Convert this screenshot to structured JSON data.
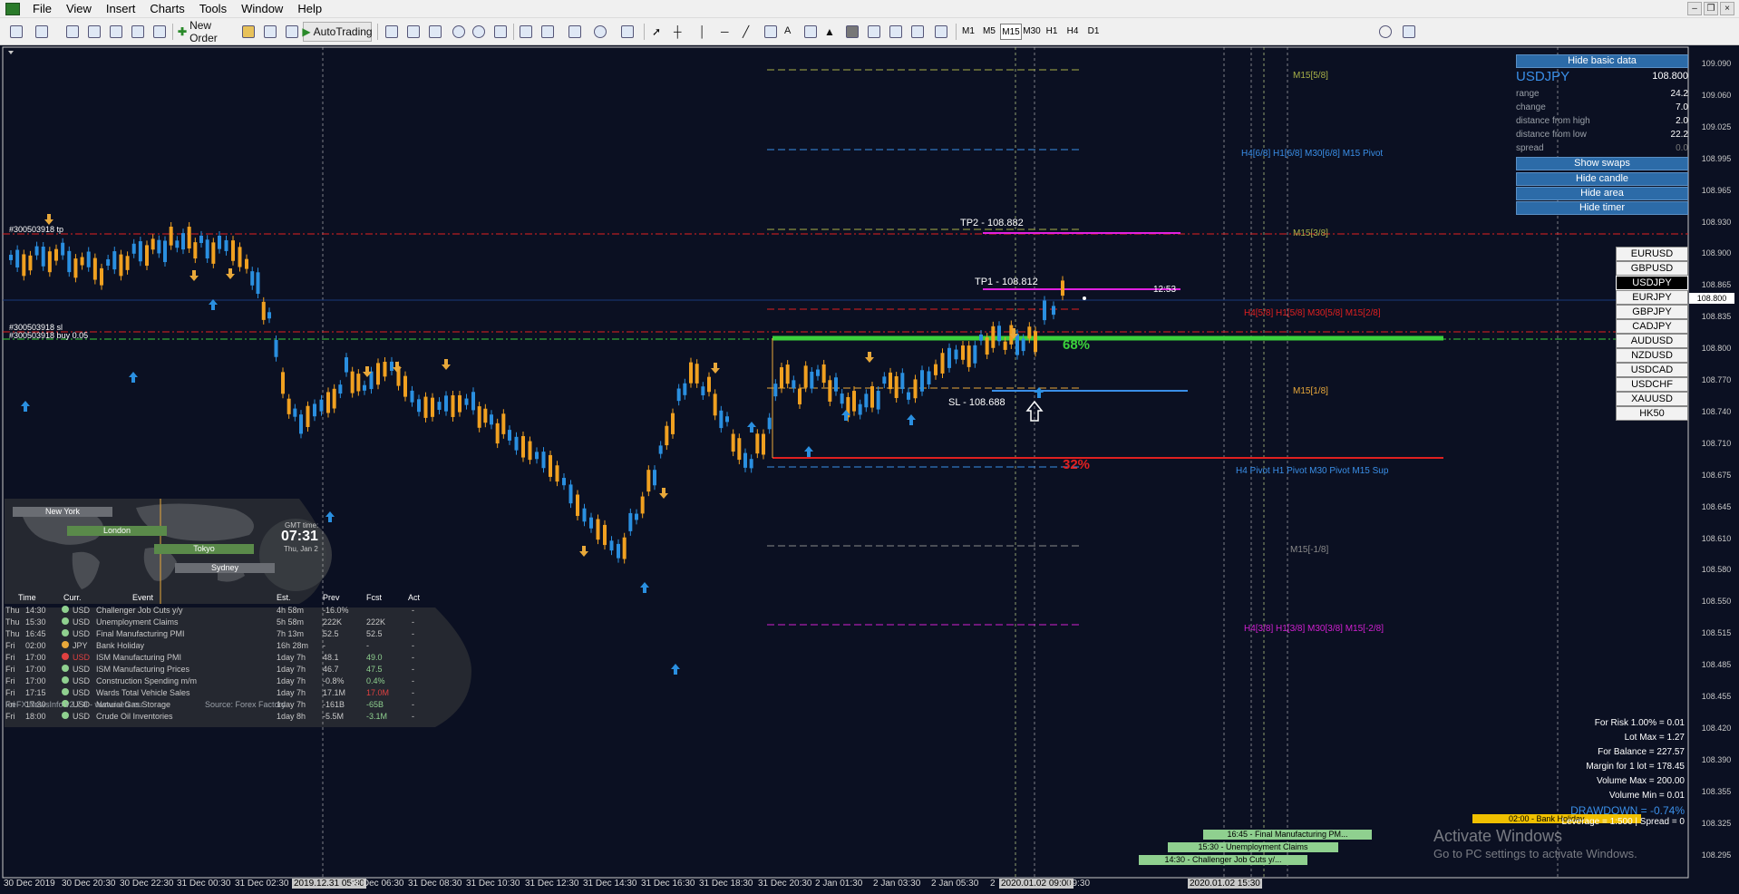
{
  "menu": [
    "File",
    "View",
    "Insert",
    "Charts",
    "Tools",
    "Window",
    "Help"
  ],
  "toolbar": {
    "new_order": "New Order",
    "autotrading": "AutoTrading",
    "timeframes": [
      "M1",
      "M5",
      "M15",
      "M30",
      "H1",
      "H4",
      "D1"
    ],
    "active_timeframe": "M15"
  },
  "price_axis": [
    "109.090",
    "109.060",
    "109.025",
    "108.995",
    "108.965",
    "108.930",
    "108.900",
    "108.865",
    "108.835",
    "108.800",
    "108.770",
    "108.740",
    "108.710",
    "108.675",
    "108.645",
    "108.610",
    "108.580",
    "108.550",
    "108.515",
    "108.485",
    "108.455",
    "108.420",
    "108.390",
    "108.355",
    "108.325",
    "108.295"
  ],
  "current_price": "108.800",
  "time_axis": [
    "30 Dec 2019",
    "30 Dec 20:30",
    "30 Dec 22:30",
    "31 Dec 00:30",
    "31 Dec 02:30",
    "2019.12.31 05:30",
    "31 Dec 06:30",
    "31 Dec 08:30",
    "31 Dec 10:30",
    "31 Dec 12:30",
    "31 Dec 14:30",
    "31 Dec 16:30",
    "31 Dec 18:30",
    "31 Dec 20:30",
    "2 Jan 01:30",
    "2 Jan 03:30",
    "2 Jan 05:30",
    "2",
    "2020.01.02 09:00",
    "09:30",
    "2020.01.02 15:30"
  ],
  "info_panel": {
    "hide_basic": "Hide basic data",
    "symbol": "USDJPY",
    "price": "108.800",
    "rows": [
      {
        "label": "range",
        "value": "24.2"
      },
      {
        "label": "change",
        "value": "7.0"
      },
      {
        "label": "distance from high",
        "value": "2.0"
      },
      {
        "label": "distance from low",
        "value": "22.2"
      },
      {
        "label": "spread",
        "value": "0.0"
      }
    ],
    "buttons": [
      "Show swaps",
      "Hide candle",
      "Hide area",
      "Hide timer"
    ]
  },
  "symbols": [
    "EURUSD",
    "GBPUSD",
    "USDJPY",
    "EURJPY",
    "GBPJPY",
    "CADJPY",
    "AUDUSD",
    "NZDUSD",
    "USDCAD",
    "USDCHF",
    "XAUUSD",
    "HK50"
  ],
  "active_symbol": "USDJPY",
  "levels": {
    "tp_label": "#300503918 tp",
    "sl_label": "#300503918 sl",
    "buy_label": "#300503918 buy 0.05",
    "tp2": "TP2 - 108.882",
    "tp1": "TP1 - 108.812",
    "sl": "SL - 108.688",
    "timer": "12:53",
    "pct_up": "68%",
    "pct_down": "32%",
    "m15_58": "M15[5/8]",
    "pivot_68": "H4[6/8] H1[6/8] M30[6/8] M15 Pivot",
    "m15_38": "M15[3/8]",
    "h4_58": "H4[5/8] H1[5/8] M30[5/8] M15[2/8]",
    "m15_18": "M15[1/8]",
    "h4_pivot": "H4 Pivot H1 Pivot M30 Pivot M15 Sup",
    "m15_m18": "M15[-1/8]",
    "h4_38": "H4[3/8] H1[3/8] M30[3/8] M15[-2/8]"
  },
  "sessions": {
    "markets": [
      "New York",
      "London",
      "Tokyo",
      "Sydney"
    ],
    "gmt_label": "GMT time:",
    "gmt_time": "07:31",
    "gmt_date": "Thu, Jan 2"
  },
  "news": {
    "headers": [
      "Time",
      "Curr.",
      "Event",
      "Est.",
      "Prev",
      "Fcst",
      "Act"
    ],
    "rows": [
      {
        "day": "Thu",
        "time": "14:30",
        "color": "#8fd08f",
        "cur": "USD",
        "event": "Challenger Job Cuts y/y",
        "est": "4h 58m",
        "prev": "-16.0%",
        "fcst": "",
        "fcst_color": "#c8c8c8",
        "act": "-"
      },
      {
        "day": "Thu",
        "time": "15:30",
        "color": "#8fd08f",
        "cur": "USD",
        "event": "Unemployment Claims",
        "est": "5h 58m",
        "prev": "222K",
        "fcst": "222K",
        "fcst_color": "#c8c8c8",
        "act": "-"
      },
      {
        "day": "Thu",
        "time": "16:45",
        "color": "#8fd08f",
        "cur": "USD",
        "event": "Final Manufacturing PMI",
        "est": "7h 13m",
        "prev": "52.5",
        "fcst": "52.5",
        "fcst_color": "#c8c8c8",
        "act": "-"
      },
      {
        "day": "Fri",
        "time": "02:00",
        "color": "#e8a83a",
        "cur": "JPY",
        "event": "Bank Holiday",
        "est": "16h 28m",
        "prev": "-",
        "fcst": "-",
        "fcst_color": "#c8c8c8",
        "act": "-"
      },
      {
        "day": "Fri",
        "time": "17:00",
        "color": "#e04040",
        "cur": "USD",
        "event": "ISM Manufacturing PMI",
        "est": "1day 7h",
        "prev": "48.1",
        "fcst": "49.0",
        "fcst_color": "#8fd08f",
        "act": "-"
      },
      {
        "day": "Fri",
        "time": "17:00",
        "color": "#8fd08f",
        "cur": "USD",
        "event": "ISM Manufacturing Prices",
        "est": "1day 7h",
        "prev": "46.7",
        "fcst": "47.5",
        "fcst_color": "#8fd08f",
        "act": "-"
      },
      {
        "day": "Fri",
        "time": "17:00",
        "color": "#8fd08f",
        "cur": "USD",
        "event": "Construction Spending m/m",
        "est": "1day 7h",
        "prev": "-0.8%",
        "fcst": "0.4%",
        "fcst_color": "#8fd08f",
        "act": "-"
      },
      {
        "day": "Fri",
        "time": "17:15",
        "color": "#8fd08f",
        "cur": "USD",
        "event": "Wards Total Vehicle Sales",
        "est": "1day 7h",
        "prev": "17.1M",
        "fcst": "17.0M",
        "fcst_color": "#e04040",
        "act": "-"
      },
      {
        "day": "Fri",
        "time": "17:30",
        "color": "#8fd08f",
        "cur": "USD",
        "event": "Natural Gas Storage",
        "est": "1day 7h",
        "prev": "-161B",
        "fcst": "-65B",
        "fcst_color": "#8fd08f",
        "act": "-"
      },
      {
        "day": "Fri",
        "time": "18:00",
        "color": "#8fd08f",
        "cur": "USD",
        "event": "Crude Oil Inventories",
        "est": "1day 8h",
        "prev": "-5.5M",
        "fcst": "-3.1M",
        "fcst_color": "#8fd08f",
        "act": "-"
      }
    ],
    "footer_left": "IceFX NewsInfo v2.7.0  -  www.icefx.eu",
    "footer_right": "Source: Forex Factory"
  },
  "risk": {
    "rows": [
      "For Risk 1.00% = 0.01",
      "Lot Max = 1.27",
      "For Balance = 227.57",
      "Margin for 1 lot = 178.45",
      "Volume Max = 200.00",
      "Volume Min = 0.01"
    ],
    "drawdown": "DRAWDOWN = -0.74%",
    "leverage": "Leverage = 1:500 | Spread = 0"
  },
  "events": {
    "bank_holiday": "02:00 - Bank Holiday",
    "pmi": "16:45 - Final Manufacturing PM...",
    "claims": "15:30 - Unemployment Claims",
    "job_cuts": "14:30 - Challenger Job Cuts y/..."
  },
  "watermark": {
    "title": "Activate Windows",
    "subtitle": "Go to PC settings to activate Windows."
  }
}
